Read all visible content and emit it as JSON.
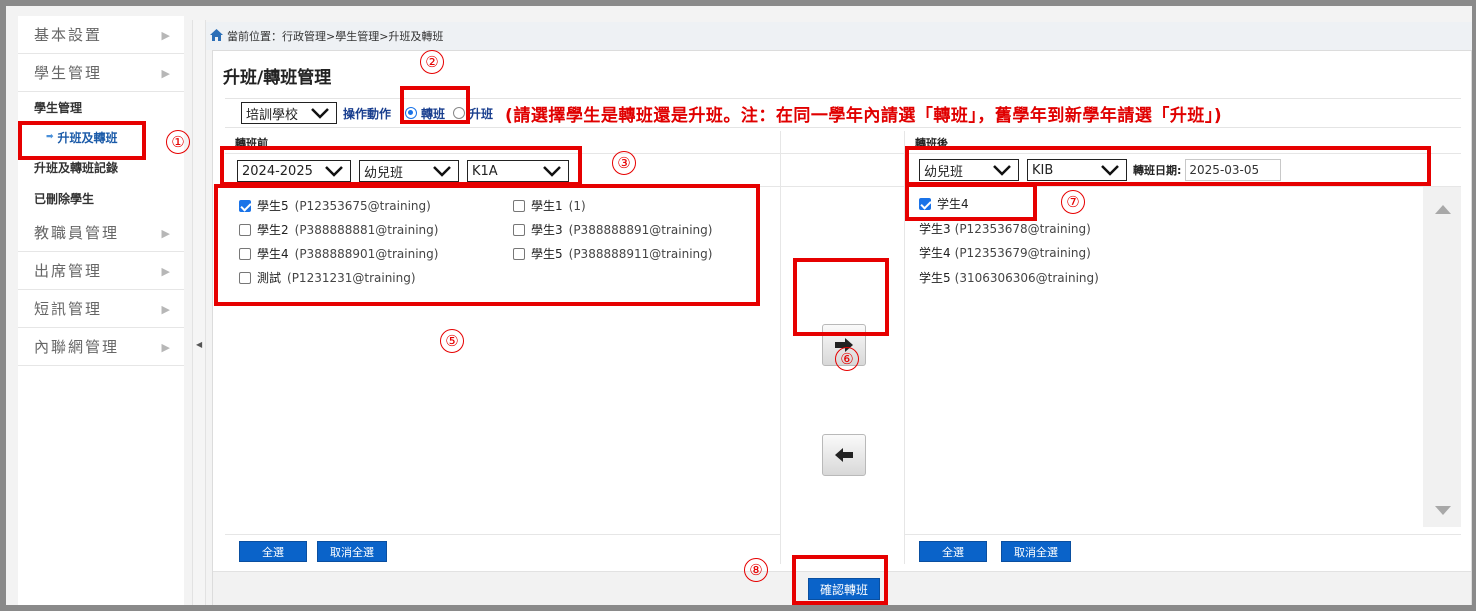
{
  "sidebar": {
    "items": [
      {
        "label": "基本設置"
      },
      {
        "label": "學生管理"
      }
    ],
    "section_title": "學生管理",
    "sub_items": [
      {
        "label": "升班及轉班"
      },
      {
        "label": "升班及轉班記錄"
      },
      {
        "label": "已刪除學生"
      }
    ],
    "bottom_items": [
      {
        "label": "教職員管理"
      },
      {
        "label": "出席管理"
      },
      {
        "label": "短訊管理"
      },
      {
        "label": "內聯網管理"
      }
    ]
  },
  "breadcrumb": {
    "text": "當前位置：行政管理>學生管理>升班及轉班"
  },
  "page": {
    "title": "升班/轉班管理",
    "school_select": "培訓學校",
    "operation_label": "操作動作",
    "radio_transfer": "轉班",
    "radio_promote": "升班",
    "hint": "(請選擇學生是轉班還是升班。注：在同一學年內請選「轉班」，舊學年到新學年請選「升班」)"
  },
  "left": {
    "header": "轉班前",
    "year_select": "2024-2025",
    "grade_select": "幼兒班",
    "class_select": "K1A",
    "students": [
      {
        "name": "學生5",
        "id": "(P12353675@training)",
        "checked": true
      },
      {
        "name": "學生1",
        "id": "(1)",
        "checked": false
      },
      {
        "name": "學生2",
        "id": "(P388888881@training)",
        "checked": false
      },
      {
        "name": "學生3",
        "id": "(P388888891@training)",
        "checked": false
      },
      {
        "name": "學生4",
        "id": "(P388888901@training)",
        "checked": false
      },
      {
        "name": "學生5",
        "id": "(P388888911@training)",
        "checked": false
      },
      {
        "name": "測試",
        "id": "(P1231231@training)",
        "checked": false
      }
    ],
    "select_all": "全選",
    "deselect_all": "取消全選"
  },
  "right": {
    "header": "轉班後",
    "grade_select": "幼兒班",
    "class_select": "KIB",
    "date_label": "轉班日期:",
    "date_value": "2025-03-05",
    "students": [
      {
        "name": "学生4",
        "id": "",
        "checked": true
      },
      {
        "name": "学生3",
        "id": "(P12353678@training)"
      },
      {
        "name": "学生4",
        "id": "(P12353679@training)"
      },
      {
        "name": "学生5",
        "id": "(3106306306@training)"
      }
    ],
    "select_all": "全選",
    "deselect_all": "取消全選"
  },
  "confirm_button": "確認轉班",
  "annotations": [
    "①",
    "②",
    "③",
    "⑤",
    "⑥",
    "⑦",
    "⑧"
  ],
  "colors": {
    "annotation_red": "#e60000",
    "button_blue": "#0a63c9",
    "hint_red": "#e00000"
  },
  "icons": {
    "home": "home-icon",
    "move_right": "arrow-right-icon",
    "move_left": "arrow-left-icon"
  }
}
